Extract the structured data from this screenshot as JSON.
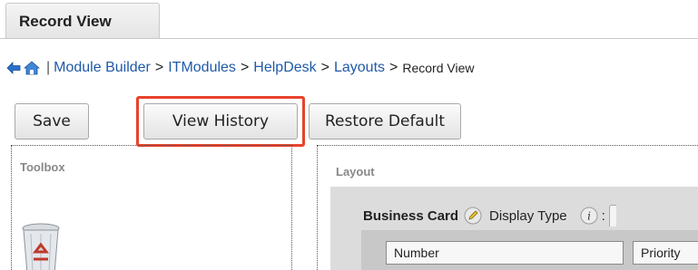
{
  "tab": {
    "label": "Record View"
  },
  "breadcrumb": {
    "separator_bar": "|",
    "items": [
      "Module Builder",
      "ITModules",
      "HelpDesk",
      "Layouts"
    ],
    "separator": ">",
    "current": "Record View"
  },
  "toolbar": {
    "save_label": "Save",
    "view_history_label": "View History",
    "restore_default_label": "Restore Default",
    "highlight_color": "#e8432c"
  },
  "toolbox": {
    "title": "Toolbox",
    "icon": "recycle-bin-icon"
  },
  "layout": {
    "title": "Layout",
    "panel_name": "Business Card",
    "display_type_label": "Display Type",
    "colon": ":",
    "fields": [
      "Number",
      "Priority"
    ]
  }
}
